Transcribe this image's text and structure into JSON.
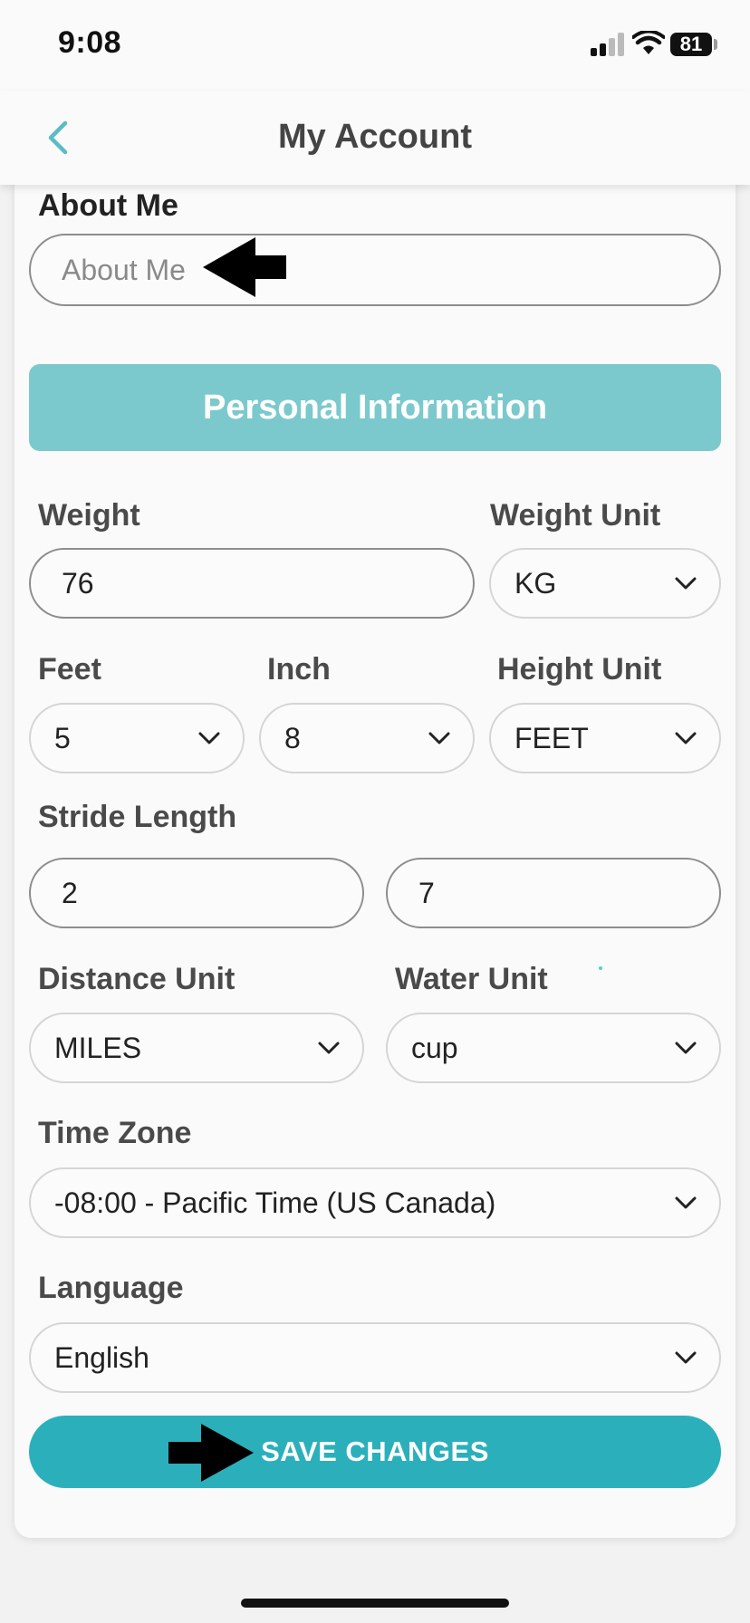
{
  "status_bar": {
    "time": "9:08",
    "battery": "81"
  },
  "nav": {
    "title": "My Account"
  },
  "about": {
    "label": "About Me",
    "placeholder": "About Me",
    "value": ""
  },
  "section": {
    "title": "Personal Information"
  },
  "weight": {
    "label": "Weight",
    "value": "76"
  },
  "weight_unit": {
    "label": "Weight Unit",
    "value": "KG"
  },
  "feet": {
    "label": "Feet",
    "value": "5"
  },
  "inch": {
    "label": "Inch",
    "value": "8"
  },
  "height_unit": {
    "label": "Height Unit",
    "value": "FEET"
  },
  "stride": {
    "label": "Stride Length",
    "value_1": "2",
    "value_2": "7"
  },
  "distance_unit": {
    "label": "Distance Unit",
    "value": "MILES"
  },
  "water_unit": {
    "label": "Water Unit",
    "value": "cup"
  },
  "time_zone": {
    "label": "Time Zone",
    "value": "-08:00 - Pacific Time (US Canada)"
  },
  "language": {
    "label": "Language",
    "value": "English"
  },
  "save": {
    "label": "SAVE CHANGES"
  },
  "colors": {
    "accent": "#2bb0bb",
    "section": "#7bc9cd",
    "back_icon": "#5bbcc4"
  }
}
